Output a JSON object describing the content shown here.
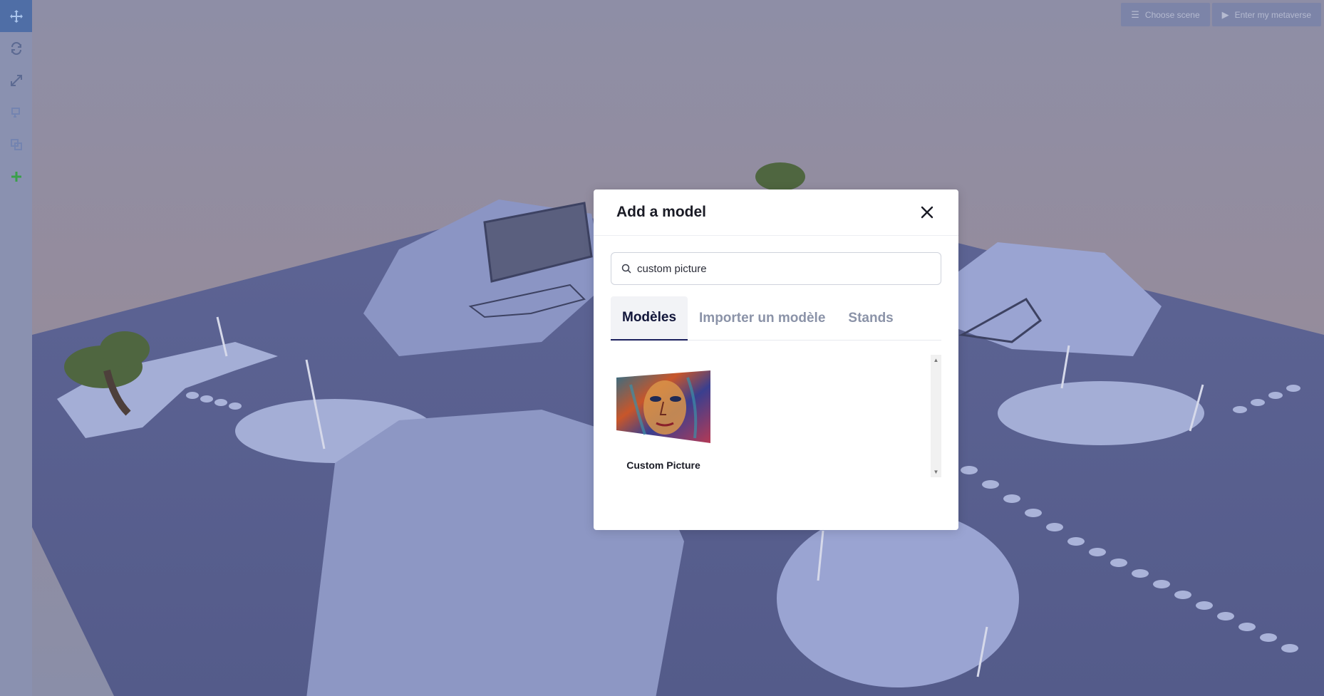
{
  "top_bar": {
    "choose_scene_label": "Choose scene",
    "enter_metaverse_label": "Enter my metaverse"
  },
  "toolbar": {
    "tools": [
      "move-icon",
      "rotate-icon",
      "scale-icon",
      "copy-icon",
      "duplicate-icon",
      "add-icon"
    ],
    "accent_color": "#4f6ea6",
    "add_color": "#3aa04a"
  },
  "modal": {
    "title": "Add a model",
    "search": {
      "value": "custom picture",
      "placeholder": ""
    },
    "tabs": [
      {
        "label": "Modèles",
        "active": true
      },
      {
        "label": "Importer un modèle",
        "active": false
      },
      {
        "label": "Stands",
        "active": false
      }
    ],
    "models": [
      {
        "label": "Custom Picture"
      }
    ]
  }
}
